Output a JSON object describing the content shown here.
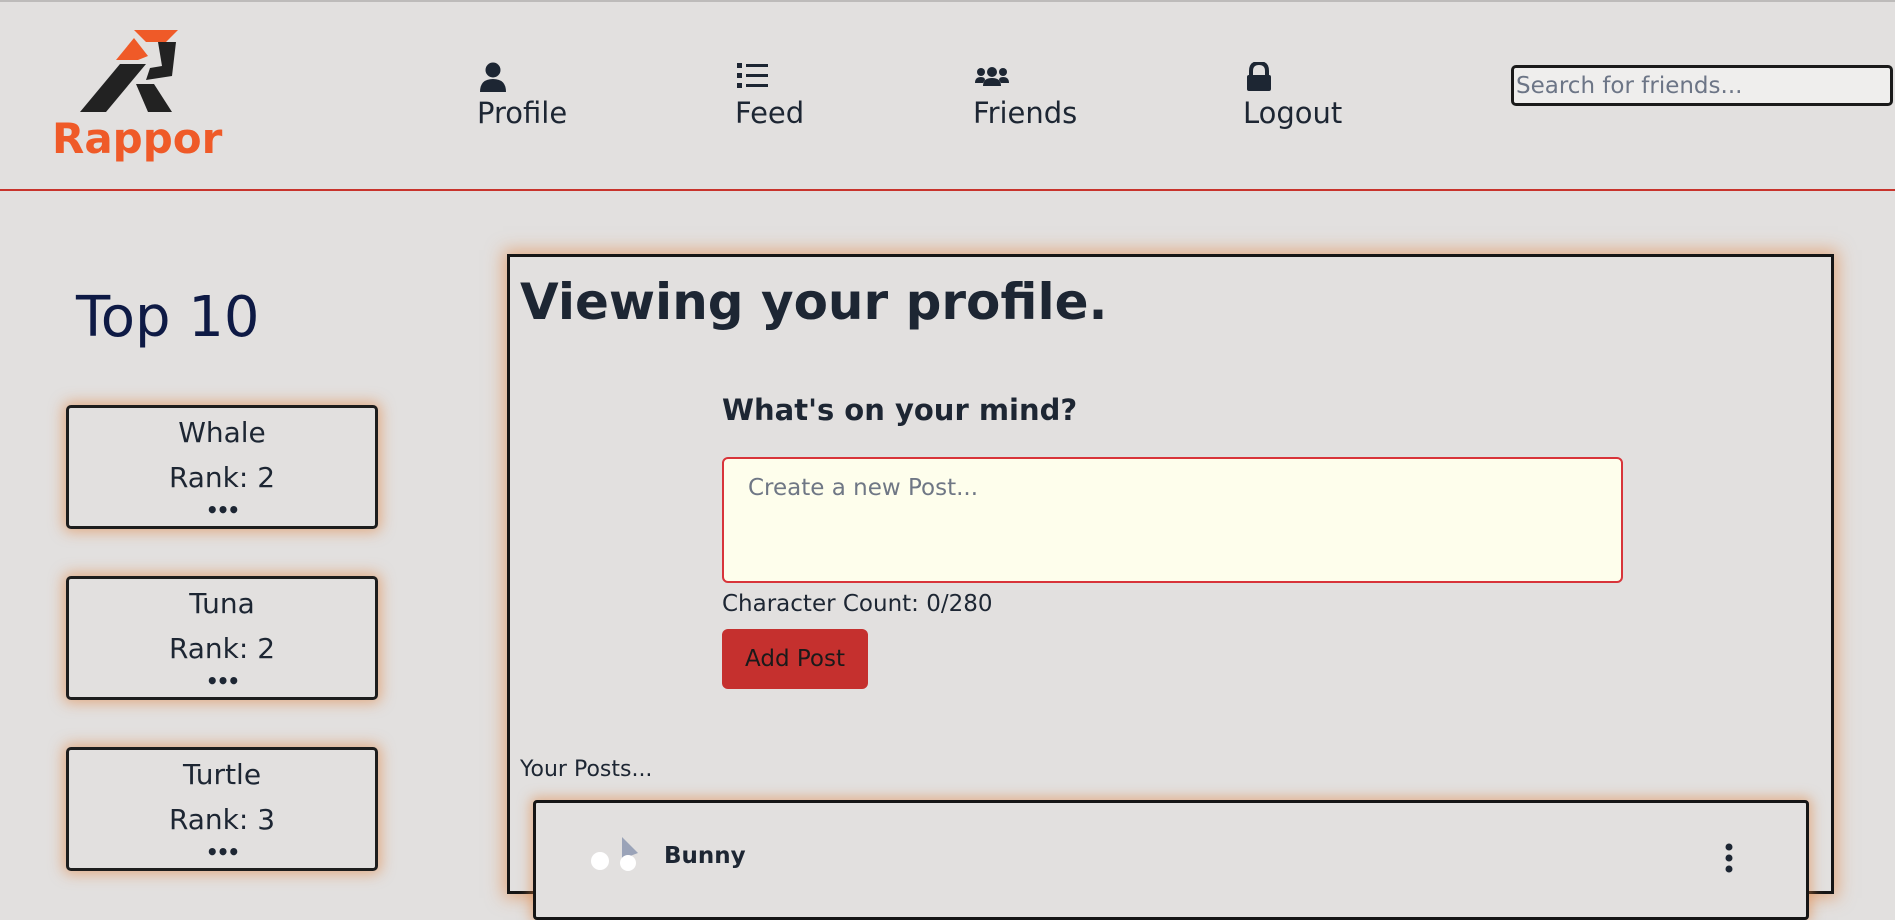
{
  "app": {
    "logo_text": "Rappor",
    "brand_color": "#ef5a28",
    "accent_color": "#c8342c"
  },
  "nav": {
    "items": [
      {
        "label": "Profile",
        "icon": "user-icon"
      },
      {
        "label": "Feed",
        "icon": "list-icon"
      },
      {
        "label": "Friends",
        "icon": "users-icon"
      },
      {
        "label": "Logout",
        "icon": "lock-icon"
      }
    ]
  },
  "search": {
    "placeholder": "Search for friends..."
  },
  "top10": {
    "title": "Top 10",
    "cards": [
      {
        "name": "Whale",
        "rank": "Rank: 2",
        "dots": "•••"
      },
      {
        "name": "Tuna",
        "rank": "Rank: 2",
        "dots": "•••"
      },
      {
        "name": "Turtle",
        "rank": "Rank: 3",
        "dots": "•••"
      }
    ]
  },
  "profile": {
    "heading": "Viewing your profile.",
    "mind_prompt": "What's on your mind?",
    "post_placeholder": "Create a new Post...",
    "char_count": "Character Count: 0/280",
    "add_button": "Add Post",
    "your_posts_label": "Your Posts..."
  },
  "posts": [
    {
      "author": "Bunny"
    }
  ]
}
